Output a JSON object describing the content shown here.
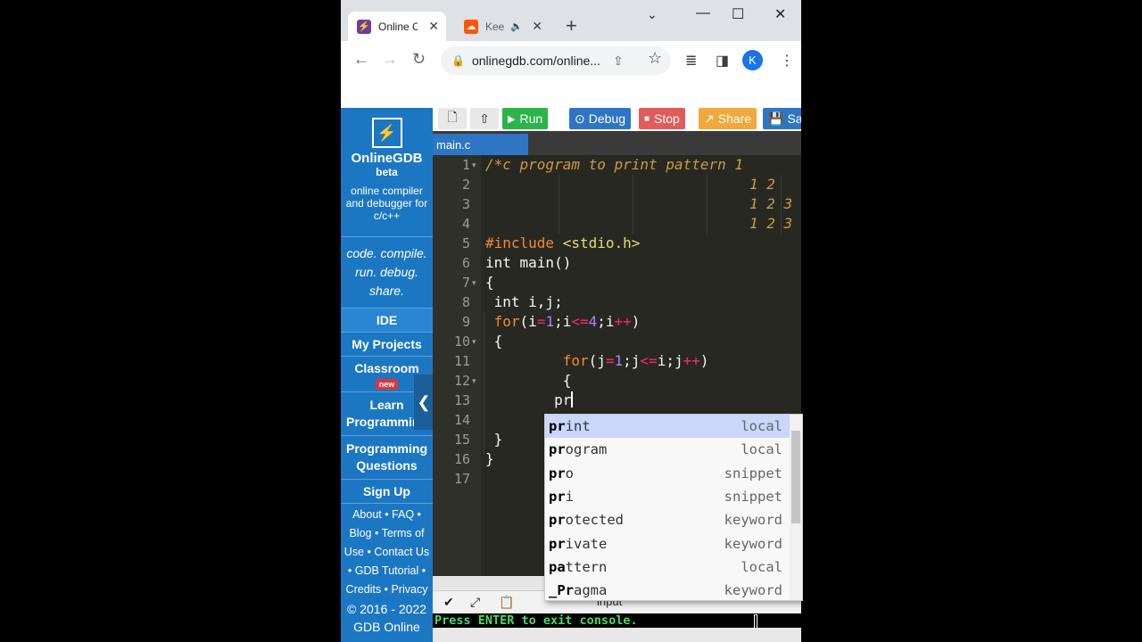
{
  "browser": {
    "tabs": [
      {
        "title": "Online C",
        "active": true
      },
      {
        "title": "Keep",
        "active": false
      }
    ],
    "url": "onlinegdb.com/online...",
    "profile_initial": "K"
  },
  "sidebar": {
    "brand": "OnlineGDB",
    "beta": "beta",
    "tagline": "online compiler and debugger for c/c++",
    "slogan_lines": [
      "code. compile.",
      "run. debug.",
      "share."
    ],
    "nav": {
      "ide": "IDE",
      "projects": "My Projects",
      "classroom": "Classroom",
      "classroom_badge": "new",
      "learn": "Learn Programming",
      "questions": "Programming Questions",
      "signup": "Sign Up"
    },
    "footer_text": "About • FAQ • Blog • Terms of Use • Contact Us • GDB Tutorial • Credits • Privacy",
    "copyright": "© 2016 - 2022 GDB Online"
  },
  "ide": {
    "buttons": {
      "run": "Run",
      "debug": "Debug",
      "stop": "Stop",
      "share": "Share",
      "save": "Save"
    },
    "file_tab": "main.c",
    "line_numbers": [
      "1",
      "2",
      "3",
      "4",
      "5",
      "6",
      "7",
      "8",
      "9",
      "10",
      "11",
      "12",
      "13",
      "14",
      "15",
      "16",
      "17"
    ],
    "comment_rows": {
      "l1": "/*c program to print pattern 1",
      "l2": "1 2",
      "l3": "1 2 3",
      "l4": "1 2 3"
    },
    "typed": "pr"
  },
  "autocomplete": [
    {
      "match": "pr",
      "rest": "int",
      "meta": "local",
      "selected": true
    },
    {
      "match": "pr",
      "rest": "ogram",
      "meta": "local",
      "selected": false
    },
    {
      "match": "pr",
      "rest": "o",
      "meta": "snippet",
      "selected": false
    },
    {
      "match": "pr",
      "rest": "i",
      "meta": "snippet",
      "selected": false
    },
    {
      "match": "pr",
      "rest": "otected",
      "meta": "keyword",
      "selected": false
    },
    {
      "match": "pr",
      "rest": "ivate",
      "meta": "keyword",
      "selected": false
    },
    {
      "match": "pa",
      "rest": "ttern",
      "meta": "local",
      "selected": false
    },
    {
      "match": "_Pr",
      "rest": "agma",
      "meta": "keyword",
      "selected": false
    }
  ],
  "console": {
    "input_label": "input",
    "output": "Press ENTER to exit console."
  },
  "colors": {
    "sidebar": "#1c77c3",
    "run": "#2cb34a",
    "debug": "#2e75c4",
    "stop": "#e25b5b",
    "share": "#f0a93a",
    "editor_bg": "#272822"
  }
}
